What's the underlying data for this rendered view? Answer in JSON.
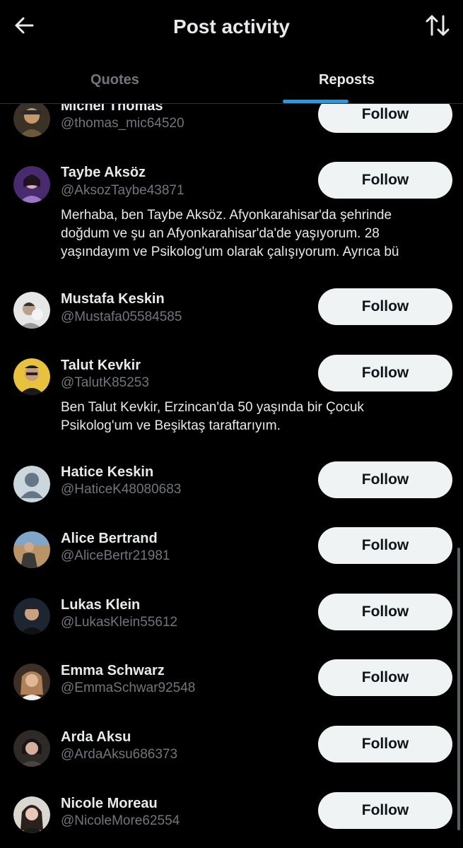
{
  "header": {
    "title": "Post activity",
    "back_icon": "arrow-left-icon",
    "sort_icon": "sort-arrows-icon"
  },
  "tabs": [
    {
      "label": "Quotes",
      "active": false
    },
    {
      "label": "Reposts",
      "active": true
    }
  ],
  "accent_color": "#1d9bf0",
  "users": [
    {
      "name": "Michel Thomas",
      "handle": "@thomas_mic64520",
      "bio": "",
      "follow_label": "Follow",
      "avatar_color": "#6b5a3a"
    },
    {
      "name": "Taybe Aksöz",
      "handle": "@AksozTaybe43871",
      "bio": "Merhaba, ben Taybe Aksöz. Afyonkarahisar'da şehrinde doğdum ve şu an Afyonkarahisar'da'de yaşıyorum. 28 yaşındayım ve Psikolog'um olarak çalışıyorum. Ayrıca bü",
      "follow_label": "Follow",
      "avatar_color": "#7a4fb0"
    },
    {
      "name": "Mustafa Keskin",
      "handle": "@Mustafa05584585",
      "bio": "",
      "follow_label": "Follow",
      "avatar_color": "#cfcfcf"
    },
    {
      "name": "Talut Kevkir",
      "handle": "@TalutK85253",
      "bio": "Ben Talut Kevkir, Erzincan'da 50 yaşında bir Çocuk Psikolog'um ve Beşiktaş taraftarıyım.",
      "follow_label": "Follow",
      "avatar_color": "#d9b23a"
    },
    {
      "name": "Hatice Keskin",
      "handle": "@HaticeK48080683",
      "bio": "",
      "follow_label": "Follow",
      "avatar_color": "#ccd6dd"
    },
    {
      "name": "Alice Bertrand",
      "handle": "@AliceBertr21981",
      "bio": "",
      "follow_label": "Follow",
      "avatar_color": "#9b7b55"
    },
    {
      "name": "Lukas Klein",
      "handle": "@LukasKlein55612",
      "bio": "",
      "follow_label": "Follow",
      "avatar_color": "#2b3440"
    },
    {
      "name": "Emma Schwarz",
      "handle": "@EmmaSchwar92548",
      "bio": "",
      "follow_label": "Follow",
      "avatar_color": "#8a6a50"
    },
    {
      "name": "Arda Aksu",
      "handle": "@ArdaAksu686373",
      "bio": "",
      "follow_label": "Follow",
      "avatar_color": "#5a5048"
    },
    {
      "name": "Nicole Moreau",
      "handle": "@NicoleMore62554",
      "bio": "",
      "follow_label": "Follow",
      "avatar_color": "#6e5a52"
    }
  ]
}
